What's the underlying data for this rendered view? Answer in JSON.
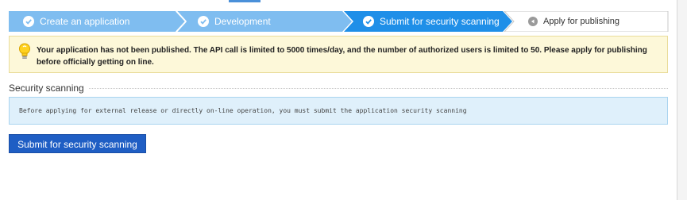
{
  "wizard": {
    "steps": [
      {
        "label": "Create an application",
        "state": "done",
        "icon": "check-icon"
      },
      {
        "label": "Development",
        "state": "done",
        "icon": "check-icon"
      },
      {
        "label": "Submit for security scanning",
        "state": "current",
        "icon": "check-icon"
      },
      {
        "label": "Apply for publishing",
        "state": "todo",
        "icon": "arrow-left-icon"
      }
    ]
  },
  "notice": {
    "icon": "lightbulb-icon",
    "message": "Your application has not been published. The API call is limited to 5000 times/day, and the number of authorized users is limited to 50. Please apply for publishing before officially getting on line."
  },
  "section": {
    "title": "Security scanning",
    "info": "Before applying for external release or directly on-line operation, you must submit the application security scanning"
  },
  "actions": {
    "submit_label": "Submit for security scanning"
  },
  "colors": {
    "done_step": "#7fbdf0",
    "current_step": "#1f8fe8",
    "todo_step": "#ffffff",
    "button": "#1f5ec4",
    "notice_bg": "#fdf8d9",
    "info_bg": "#dff0fb"
  }
}
